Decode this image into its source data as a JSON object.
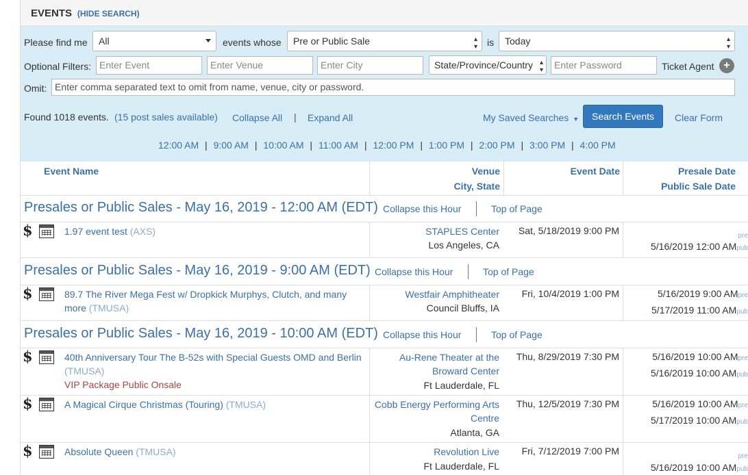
{
  "header": {
    "title": "EVENTS",
    "hide_search": "(HIDE SEARCH)"
  },
  "search": {
    "find_label": "Please find me",
    "find_value": "All",
    "whose_label": "events whose",
    "field_value": "Pre or Public Sale",
    "is_label": "is",
    "when_value": "Today",
    "filters_label": "Optional Filters:",
    "event_placeholder": "Enter Event",
    "venue_placeholder": "Enter Venue",
    "city_placeholder": "Enter City",
    "region_value": "State/Province/Country",
    "password_placeholder": "Enter Password",
    "ticket_agent_label": "Ticket Agent",
    "plus_symbol": "+",
    "omit_label": "Omit:",
    "omit_placeholder": "Enter comma separated text to omit from name, venue, city or password."
  },
  "results": {
    "found_text": "Found 1018 events.",
    "post_sales": "(15 post sales available)",
    "collapse_all": "Collapse All",
    "divider": "|",
    "expand_all": "Expand All",
    "saved_searches": "My Saved Searches",
    "search_button": "Search Events",
    "clear_form": "Clear Form"
  },
  "hours": [
    "12:00 AM",
    "9:00 AM",
    "10:00 AM",
    "11:00 AM",
    "12:00 PM",
    "1:00 PM",
    "2:00 PM",
    "3:00 PM",
    "4:00 PM"
  ],
  "hour_separator": "|",
  "columns": {
    "event_name": "Event Name",
    "venue": "Venue",
    "city_state": "City, State",
    "event_date": "Event Date",
    "presale_date": "Presale Date",
    "public_sale_date": "Public Sale Date"
  },
  "groups": [
    {
      "title": "Presales or Public Sales - May 16, 2019 - 12:00 AM (EDT)",
      "collapse": "Collapse this Hour",
      "top": "Top of Page"
    },
    {
      "title": "Presales or Public Sales - May 16, 2019 - 9:00 AM (EDT)",
      "collapse": "Collapse this Hour",
      "top": "Top of Page"
    },
    {
      "title": "Presales or Public Sales - May 16, 2019 - 10:00 AM (EDT)",
      "collapse": "Collapse this Hour",
      "top": "Top of Page"
    }
  ],
  "events": [
    {
      "name": "1.97 event test",
      "agent": "(AXS)",
      "name_line2": "",
      "extra": "",
      "venue": "STAPLES Center",
      "venue_line2": "",
      "city": "Los Angeles, CA",
      "event_date": "Sat, 5/18/2019 9:00 PM",
      "presale": "",
      "public_sale": "5/16/2019 12:00 AM"
    },
    {
      "name": "89.7 The River Mega Fest w/ Dropkick Murphys, Clutch, and many",
      "name_line2": "more",
      "agent": "(TMUSA)",
      "extra": "",
      "venue": "Westfair Amphitheater",
      "venue_line2": "",
      "city": "Council Bluffs, IA",
      "event_date": "Fri, 10/4/2019 1:00 PM",
      "presale": "5/16/2019 9:00 AM",
      "public_sale": "5/17/2019 11:00 AM"
    },
    {
      "name": "40th Anniversary Tour The B-52s with Special Guests OMD and Berlin",
      "name_line2": "",
      "agent": "(TMUSA)",
      "extra": "VIP Package Public Onsale",
      "venue": "Au-Rene Theater at the",
      "venue_line2": "Broward Center",
      "city": "Ft Lauderdale, FL",
      "event_date": "Thu, 8/29/2019 7:30 PM",
      "presale": "5/16/2019 10:00 AM",
      "public_sale": "5/16/2019 10:00 AM"
    },
    {
      "name": "A Magical Cirque Christmas (Touring)",
      "name_line2": "",
      "agent": "(TMUSA)",
      "extra": "",
      "venue": "Cobb Energy Performing Arts",
      "venue_line2": "Centre",
      "city": "Atlanta, GA",
      "event_date": "Thu, 12/5/2019 7:30 PM",
      "presale": "5/16/2019 10:00 AM",
      "public_sale": "5/17/2019 10:00 AM"
    },
    {
      "name": "Absolute Queen",
      "name_line2": "",
      "agent": "(TMUSA)",
      "extra": "",
      "venue": "Revolution Live",
      "venue_line2": "",
      "city": "Ft Lauderdale, FL",
      "event_date": "Fri, 7/12/2019 7:00 PM",
      "presale": "",
      "public_sale": "5/16/2019 10:00 AM"
    }
  ],
  "tags": {
    "pre": "pre",
    "pub": "pub",
    "dollar": "$"
  },
  "icons": [
    "dollar-icon",
    "calendar-icon",
    "caret-down-icon",
    "plus-icon"
  ],
  "colors": {
    "link": "#3a70a8",
    "panel": "#d9edf7",
    "primary": "#3178bd",
    "vip": "#a94442",
    "agent": "#8aaccc"
  }
}
